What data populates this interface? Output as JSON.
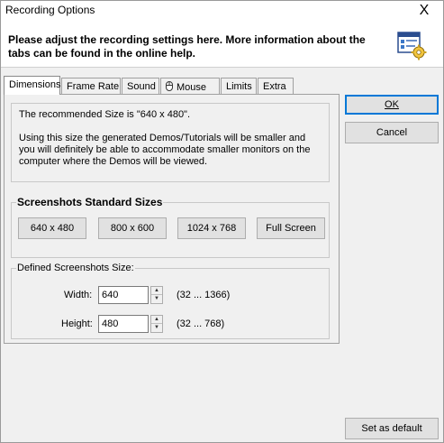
{
  "window": {
    "title": "Recording Options",
    "close_glyph": "X"
  },
  "header": {
    "message": "Please adjust the recording settings here. More information about the tabs can be found in the online help.",
    "icon": "settings-window-gear-icon"
  },
  "tabs": [
    {
      "label": "Dimensions",
      "active": true
    },
    {
      "label": "Frame Rate",
      "active": false
    },
    {
      "label": "Sound",
      "active": false
    },
    {
      "label": "Mouse",
      "active": false,
      "icon": "mouse-icon"
    },
    {
      "label": "Limits",
      "active": false
    },
    {
      "label": "Extra",
      "active": false
    }
  ],
  "info": {
    "line1": "The recommended Size is \"640 x 480\".",
    "line2": "Using this size the generated Demos/Tutorials will be smaller and you will definitely be able to accommodate smaller monitors on the computer where the Demos will be viewed."
  },
  "standard_sizes": {
    "title": "Screenshots Standard Sizes",
    "buttons": [
      "640 x 480",
      "800 x 600",
      "1024 x 768",
      "Full Screen"
    ]
  },
  "defined_size": {
    "title": "Defined Screenshots Size:",
    "width_label": "Width:",
    "width_value": "640",
    "width_range": "(32 ... 1366)",
    "height_label": "Height:",
    "height_value": "480",
    "height_range": "(32 ... 768)"
  },
  "buttons": {
    "ok_label": "OK",
    "cancel_label": "Cancel",
    "set_default_label": "Set as default"
  },
  "colors": {
    "focus_border": "#0078d7",
    "dialog_bg": "#f0f0f0"
  }
}
